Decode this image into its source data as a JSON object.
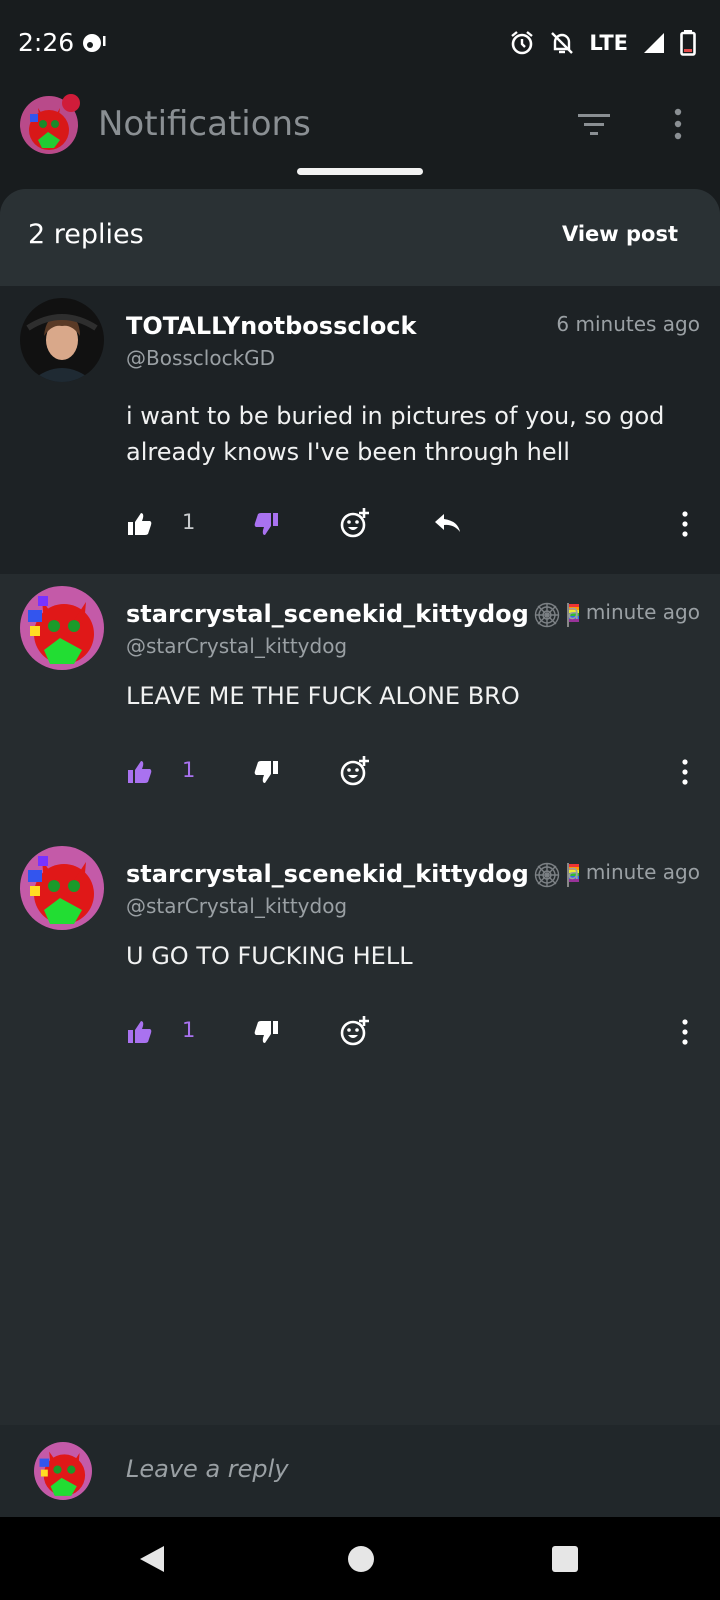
{
  "status_bar": {
    "time": "2:26",
    "network": "LTE"
  },
  "app_bar": {
    "title": "Notifications"
  },
  "sheet": {
    "reply_count": "2 replies",
    "view_post_label": "View post"
  },
  "comments": [
    {
      "author": "TOTALLYnotbossclock",
      "handle": "@BossclockGD",
      "time": "6 minutes ago",
      "body": "i want to be buried in pictures of you, so god already knows I've been through hell",
      "likes": "1",
      "liked": false,
      "disliked": true
    },
    {
      "author": "starcrystal_scenekid_kittydog",
      "handle": "@starCrystal_kittydog",
      "time": "a minute ago",
      "body": "LEAVE ME THE FUCK ALONE BRO",
      "likes": "1",
      "liked": true,
      "disliked": false
    },
    {
      "author": "starcrystal_scenekid_kittydog",
      "handle": "@starCrystal_kittydog",
      "time": "a minute ago",
      "body": "U GO TO FUCKING HELL",
      "likes": "1",
      "liked": true,
      "disliked": false
    }
  ],
  "compose": {
    "placeholder": "Leave a reply"
  },
  "colors": {
    "accent": "#a972f0",
    "badge": "#d01c3a",
    "sheet": "#262c2f"
  },
  "icons": [
    "alarm-icon",
    "bell-off-icon",
    "signal-icon",
    "battery-icon",
    "filter-icon",
    "more-vert-icon",
    "thumbs-up-icon",
    "thumbs-down-icon",
    "add-reaction-icon",
    "reply-icon"
  ]
}
